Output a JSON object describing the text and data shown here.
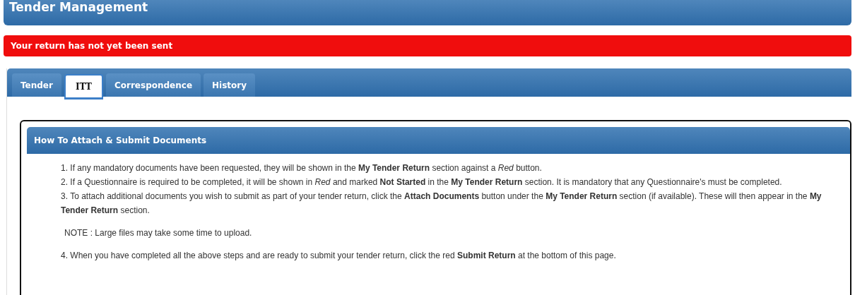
{
  "page_title": "Tender Management",
  "alert": "Your return has not yet been sent",
  "tabs": [
    {
      "label": "Tender",
      "selected": false
    },
    {
      "label": "ITT",
      "selected": true
    },
    {
      "label": "Correspondence",
      "selected": false
    },
    {
      "label": "History",
      "selected": false
    }
  ],
  "panel": {
    "title": "How To Attach & Submit Documents",
    "steps": [
      {
        "kind": "step",
        "text": "1. If any mandatory documents have been requested, they will be shown in the **My Tender Return** section against a *Red* button."
      },
      {
        "kind": "step",
        "text": "2. If a Questionnaire is required to be completed, it will be shown in *Red* and marked **Not Started** in the **My Tender Return** section. It is mandatory that any Questionnaire's must be completed."
      },
      {
        "kind": "step",
        "text": "3. To attach additional documents you wish to submit as part of your tender return, click the **Attach Documents** button under the **My Tender Return** section (if available). These will then appear in the **My Tender Return** section."
      },
      {
        "kind": "note",
        "text": "NOTE : Large files may take some time to upload."
      },
      {
        "kind": "step",
        "text": "4. When you have completed all the above steps and are ready to submit your tender return, click the red **Submit Return** at the bottom of this page."
      }
    ]
  }
}
